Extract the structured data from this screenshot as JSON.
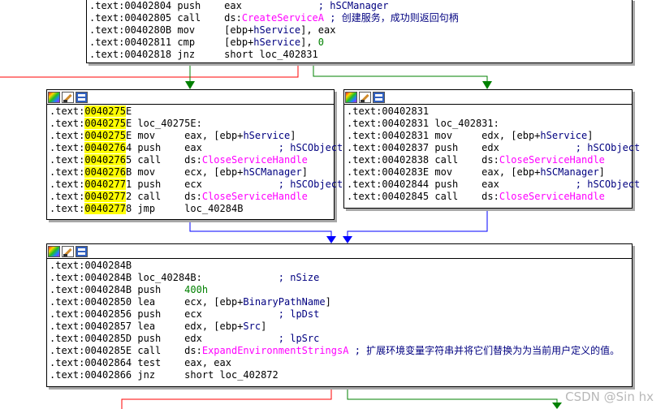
{
  "blocks": {
    "top": {
      "lines": [
        {
          "seg": [
            {
              "t": ".text:00402804 push    eax             "
            },
            {
              "t": "; hSCManager",
              "c": "cm"
            }
          ]
        },
        {
          "seg": [
            {
              "t": ".text:00402805 call    ds:"
            },
            {
              "t": "CreateServiceA",
              "c": "fn"
            },
            {
              "t": " ; ",
              "c": "cm"
            },
            {
              "t": "创建服务，成功则返回句柄",
              "c": "cm cjk"
            }
          ]
        },
        {
          "seg": [
            {
              "t": ".text:0040280B mov     [ebp+"
            },
            {
              "t": "hService",
              "c": "nm"
            },
            {
              "t": "], eax"
            }
          ]
        },
        {
          "seg": [
            {
              "t": ".text:00402811 cmp     [ebp+"
            },
            {
              "t": "hService",
              "c": "nm"
            },
            {
              "t": "], "
            },
            {
              "t": "0",
              "c": "num"
            }
          ]
        },
        {
          "seg": [
            {
              "t": ".text:00402818 jnz     short loc_402831"
            }
          ]
        }
      ]
    },
    "left": {
      "lines": [
        {
          "seg": [
            {
              "t": ".text:"
            },
            {
              "t": "0040275",
              "c": "hl"
            },
            {
              "t": "E"
            }
          ]
        },
        {
          "seg": [
            {
              "t": ".text:"
            },
            {
              "t": "0040275",
              "c": "hl"
            },
            {
              "t": "E loc_40275E:"
            }
          ]
        },
        {
          "seg": [
            {
              "t": ".text:"
            },
            {
              "t": "0040275",
              "c": "hl"
            },
            {
              "t": "E mov     eax, [ebp+"
            },
            {
              "t": "hService",
              "c": "nm"
            },
            {
              "t": "]"
            }
          ]
        },
        {
          "seg": [
            {
              "t": ".text:"
            },
            {
              "t": "0040276",
              "c": "hl"
            },
            {
              "t": "4 push    eax             "
            },
            {
              "t": "; hSCObject",
              "c": "cm"
            }
          ]
        },
        {
          "seg": [
            {
              "t": ".text:"
            },
            {
              "t": "0040276",
              "c": "hl"
            },
            {
              "t": "5 call    ds:"
            },
            {
              "t": "CloseServiceHandle",
              "c": "fn"
            }
          ]
        },
        {
          "seg": [
            {
              "t": ".text:"
            },
            {
              "t": "0040276",
              "c": "hl"
            },
            {
              "t": "B mov     ecx, [ebp+"
            },
            {
              "t": "hSCManager",
              "c": "nm"
            },
            {
              "t": "]"
            }
          ]
        },
        {
          "seg": [
            {
              "t": ".text:"
            },
            {
              "t": "0040277",
              "c": "hl"
            },
            {
              "t": "1 push    ecx             "
            },
            {
              "t": "; hSCObject",
              "c": "cm"
            }
          ]
        },
        {
          "seg": [
            {
              "t": ".text:"
            },
            {
              "t": "0040277",
              "c": "hl"
            },
            {
              "t": "2 call    ds:"
            },
            {
              "t": "CloseServiceHandle",
              "c": "fn"
            }
          ]
        },
        {
          "seg": [
            {
              "t": ".text:"
            },
            {
              "t": "0040277",
              "c": "hl"
            },
            {
              "t": "8 jmp     loc_40284B"
            }
          ]
        }
      ]
    },
    "right": {
      "lines": [
        {
          "seg": [
            {
              "t": ".text:00402831"
            }
          ]
        },
        {
          "seg": [
            {
              "t": ".text:00402831 loc_402831:"
            }
          ]
        },
        {
          "seg": [
            {
              "t": ".text:00402831 mov     edx, [ebp+"
            },
            {
              "t": "hService",
              "c": "nm"
            },
            {
              "t": "]"
            }
          ]
        },
        {
          "seg": [
            {
              "t": ".text:00402837 push    edx             "
            },
            {
              "t": "; hSCObject",
              "c": "cm"
            }
          ]
        },
        {
          "seg": [
            {
              "t": ".text:00402838 call    ds:"
            },
            {
              "t": "CloseServiceHandle",
              "c": "fn"
            }
          ]
        },
        {
          "seg": [
            {
              "t": ".text:0040283E mov     eax, [ebp+"
            },
            {
              "t": "hSCManager",
              "c": "nm"
            },
            {
              "t": "]"
            }
          ]
        },
        {
          "seg": [
            {
              "t": ".text:00402844 push    eax             "
            },
            {
              "t": "; hSCObject",
              "c": "cm"
            }
          ]
        },
        {
          "seg": [
            {
              "t": ".text:00402845 call    ds:"
            },
            {
              "t": "CloseServiceHandle",
              "c": "fn"
            }
          ]
        }
      ]
    },
    "bottom": {
      "lines": [
        {
          "seg": [
            {
              "t": ".text:0040284B"
            }
          ]
        },
        {
          "seg": [
            {
              "t": ".text:0040284B loc_40284B:             "
            },
            {
              "t": "; nSize",
              "c": "cm"
            }
          ]
        },
        {
          "seg": [
            {
              "t": ".text:0040284B push    "
            },
            {
              "t": "400h",
              "c": "num"
            }
          ]
        },
        {
          "seg": [
            {
              "t": ".text:00402850 lea     ecx, [ebp+"
            },
            {
              "t": "BinaryPathName",
              "c": "nm"
            },
            {
              "t": "]"
            }
          ]
        },
        {
          "seg": [
            {
              "t": ".text:00402856 push    ecx             "
            },
            {
              "t": "; lpDst",
              "c": "cm"
            }
          ]
        },
        {
          "seg": [
            {
              "t": ".text:00402857 lea     edx, [ebp+"
            },
            {
              "t": "Src",
              "c": "nm"
            },
            {
              "t": "]"
            }
          ]
        },
        {
          "seg": [
            {
              "t": ".text:0040285D push    edx             "
            },
            {
              "t": "; lpSrc",
              "c": "cm"
            }
          ]
        },
        {
          "seg": [
            {
              "t": ".text:0040285E call    ds:"
            },
            {
              "t": "ExpandEnvironmentStringsA",
              "c": "fn"
            },
            {
              "t": " ; ",
              "c": "cm"
            },
            {
              "t": "扩展环境变量字符串并将它们替换为为当前用户定义的值。",
              "c": "cm cjk"
            }
          ]
        },
        {
          "seg": [
            {
              "t": ".text:00402864 test    eax, eax"
            }
          ]
        },
        {
          "seg": [
            {
              "t": ".text:00402866 jnz     short loc_402872"
            }
          ]
        }
      ]
    }
  },
  "toolbar_icons": [
    "color-palette-icon",
    "edit-pencil-icon",
    "graph-overview-icon"
  ],
  "edge_colors": {
    "true_branch": "#008000",
    "false_branch": "#ff0000",
    "unconditional": "#0000ff"
  },
  "watermark": "CSDN @Sin hx"
}
